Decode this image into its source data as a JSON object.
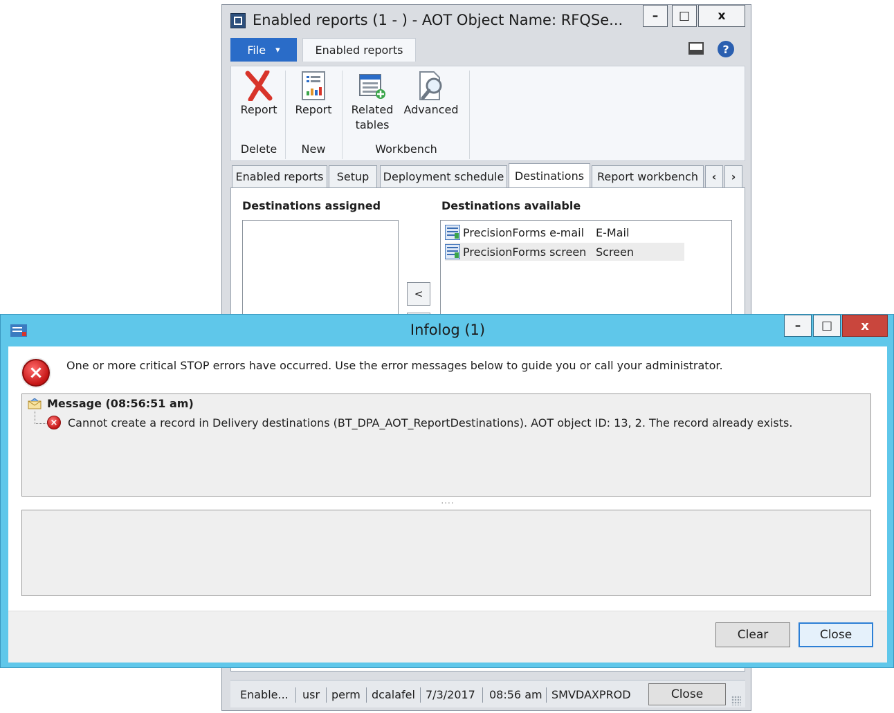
{
  "bg_window": {
    "title": "Enabled reports (1 -        ) - AOT Object Name: RFQSe...",
    "controls": {
      "minimize": "–",
      "maximize": "□",
      "close": "x"
    },
    "ribbon_tabs": {
      "file": "File",
      "file_arrow": "▾",
      "enabled_reports": "Enabled reports"
    },
    "help_glyph": "?",
    "ribbon": {
      "groups": [
        {
          "label": "Delete",
          "buttons": [
            {
              "label": "Report",
              "icon": "red-x-icon"
            }
          ]
        },
        {
          "label": "New",
          "buttons": [
            {
              "label": "Report",
              "icon": "report-icon"
            }
          ]
        },
        {
          "label": "Workbench",
          "buttons": [
            {
              "label_line1": "Related",
              "label_line2": "tables",
              "icon": "related-tables-icon"
            },
            {
              "label": "Advanced",
              "icon": "advanced-icon"
            }
          ]
        }
      ]
    },
    "tabs": [
      {
        "label": "Enabled reports"
      },
      {
        "label": "Setup"
      },
      {
        "label": "Deployment schedule"
      },
      {
        "label": "Destinations",
        "active": true
      },
      {
        "label": "Report workbench"
      }
    ],
    "tab_scroll": {
      "left": "‹",
      "right": "›"
    },
    "destinations": {
      "assigned_label": "Destinations assigned",
      "available_label": "Destinations available",
      "move_left": "<",
      "available": [
        {
          "name": "PrecisionForms e-mail",
          "type": "E-Mail"
        },
        {
          "name": "PrecisionForms screen",
          "type": "Screen",
          "selected": true
        }
      ]
    },
    "status_bar": {
      "items": [
        "Enable...",
        "usr",
        "perm",
        "dcalafel",
        "7/3/2017",
        "08:56 am",
        "SMVDAXPROD"
      ],
      "close": "Close"
    }
  },
  "infolog": {
    "title": "Infolog (1)",
    "controls": {
      "minimize": "–",
      "maximize": "□",
      "close": "x"
    },
    "header_message": "One or more critical STOP errors have occurred. Use the error messages below to guide you or call your administrator.",
    "message_group": "Message (08:56:51 am)",
    "error_message": "Cannot create a record in Delivery destinations (BT_DPA_AOT_ReportDestinations). AOT object ID: 13, 2. The record already exists.",
    "splitter": "....",
    "buttons": {
      "clear": "Clear",
      "close": "Close"
    },
    "colors": {
      "frame": "#5fc7ea",
      "close_button": "#c9463d",
      "error": "#c51414"
    }
  }
}
